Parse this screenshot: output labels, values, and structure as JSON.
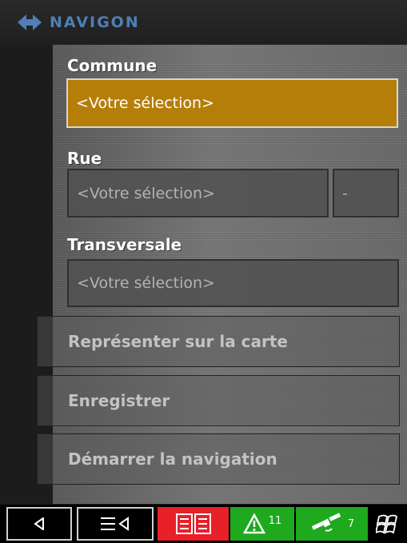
{
  "header": {
    "brand": "NAVIGON"
  },
  "form": {
    "commune": {
      "label": "Commune",
      "value": "<Votre sélection>"
    },
    "rue": {
      "label": "Rue",
      "value": "<Votre sélection>",
      "number": "-"
    },
    "transversale": {
      "label": "Transversale",
      "value": "<Votre sélection>"
    }
  },
  "actions": {
    "show_map": "Représenter sur la carte",
    "save": "Enregistrer",
    "start_navigation": "Démarrer la navigation"
  },
  "taskbar": {
    "tmc_count": "11",
    "gps_count": "7",
    "colors": {
      "red": "#e8202a",
      "green": "#1ea91e"
    }
  }
}
